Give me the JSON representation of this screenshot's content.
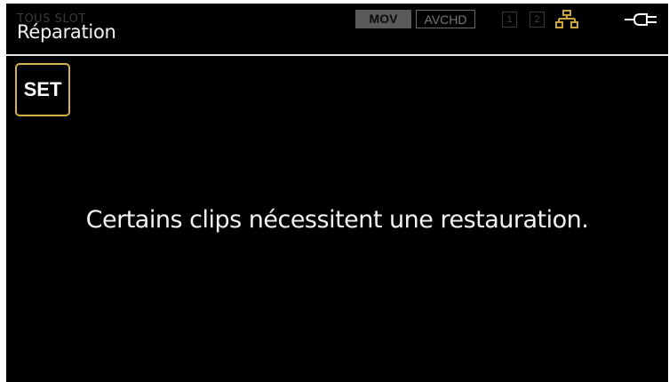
{
  "header": {
    "ghost_label": "TOUS SLOT",
    "title": "Réparation",
    "format_active": "MOV",
    "format_inactive": "AVCHD",
    "slot_1": "1",
    "slot_2": "2",
    "network_icon": "network-icon",
    "power_icon": "ac-plug-icon"
  },
  "set_button": {
    "label": "SET"
  },
  "message": "Certains clips nécessitent une restauration.",
  "colors": {
    "background": "#000000",
    "text": "#f2f2f2",
    "set_border": "#d6b24a",
    "network_icon": "#c9a43a",
    "format_active_bg": "#5a5a5a"
  }
}
